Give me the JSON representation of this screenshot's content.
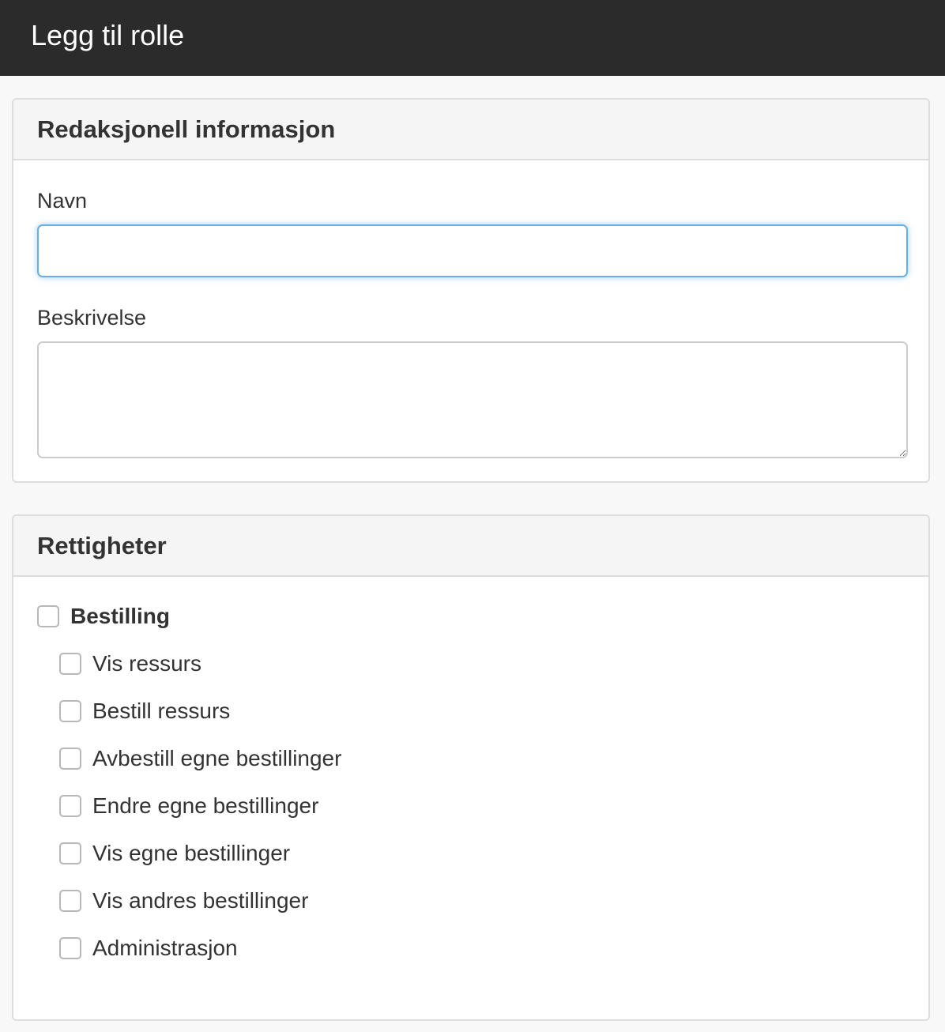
{
  "header": {
    "title": "Legg til rolle"
  },
  "info_panel": {
    "heading": "Redaksjonell informasjon",
    "name_label": "Navn",
    "name_value": "",
    "description_label": "Beskrivelse",
    "description_value": ""
  },
  "rights_panel": {
    "heading": "Rettigheter",
    "group": {
      "label": "Bestilling",
      "checked": false
    },
    "items": [
      {
        "label": "Vis ressurs",
        "checked": false
      },
      {
        "label": "Bestill ressurs",
        "checked": false
      },
      {
        "label": "Avbestill egne bestillinger",
        "checked": false
      },
      {
        "label": "Endre egne bestillinger",
        "checked": false
      },
      {
        "label": "Vis egne bestillinger",
        "checked": false
      },
      {
        "label": "Vis andres bestillinger",
        "checked": false
      },
      {
        "label": "Administrasjon",
        "checked": false
      }
    ]
  }
}
